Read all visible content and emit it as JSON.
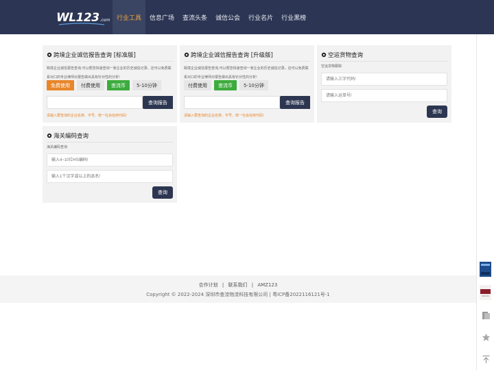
{
  "header": {
    "logo_main": "WL123",
    "logo_suffix": ".com",
    "nav": [
      {
        "label": "行业工具",
        "active": true
      },
      {
        "label": "信息广场",
        "active": false
      },
      {
        "label": "查流头条",
        "active": false
      },
      {
        "label": "诚信公会",
        "active": false
      },
      {
        "label": "行业名片",
        "active": false
      },
      {
        "label": "行业黑榜",
        "active": false
      }
    ]
  },
  "cards": {
    "standard": {
      "title": "跨境企业诚信报告查询 [标准版]",
      "desc": "跨境企业诚信报告查询,可以帮您快速查询一家企业的历史诚信记录。还可以免费联系对口的专业律师对报告做出具有针对性的分析!",
      "tags": [
        "免费使用",
        "付费使用",
        "查流币",
        "5-10分钟"
      ],
      "search_placeholder": "",
      "search_button": "查询报告",
      "hint": "请输入要查询的企业名称、字号、统一社会信用代码!"
    },
    "premium": {
      "title": "跨境企业诚信报告查询 [升级版]",
      "desc": "跨境企业诚信报告查询,可以帮您快速查询一家企业的历史诚信记录。还可以免费联系对口的专业律师对报告做出具有针对性的分析!",
      "tags": [
        "付费使用",
        "查流币",
        "5-10分钟"
      ],
      "search_placeholder": "",
      "search_button": "查询报告",
      "hint": "请输入要查询的企业名称、字号、统一社会信用代码!"
    },
    "air": {
      "title": "空运货物查询",
      "desc": "空运货物跟踪",
      "field1_placeholder": "请输入三字代码!",
      "field2_placeholder": "请输入运单号!",
      "button": "查询"
    },
    "customs": {
      "title": "海关编码查询",
      "desc": "海关编码查询",
      "field1_placeholder": "输入4~10位HS编码!",
      "field2_placeholder": "输入1个汉字或以上的品名!",
      "button": "查询"
    }
  },
  "footer": {
    "links": [
      "合作计划",
      "联系我们",
      "AMZ123"
    ],
    "separator": "|",
    "copyright": "Copyright © 2022-2024 深圳市查流物流科技有限公司 | 粤ICP备2022116121号-1"
  },
  "colors": {
    "header_bg": "#2c3553",
    "active_nav": "#f0a63a",
    "orange": "#e8862a",
    "green": "#3cac3c",
    "button_dark": "#2d3651"
  }
}
